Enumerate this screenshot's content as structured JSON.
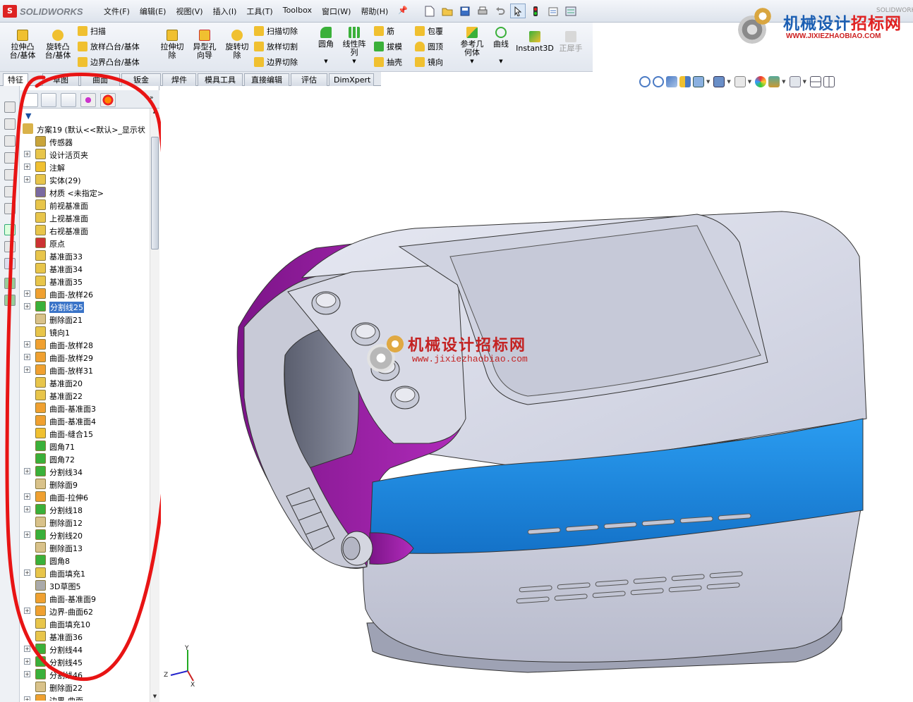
{
  "app": {
    "name": "SOLIDWORKS",
    "logo_icon": "sw-logo-icon"
  },
  "menus": [
    "文件(F)",
    "编辑(E)",
    "视图(V)",
    "插入(I)",
    "工具(T)",
    "Toolbox",
    "窗口(W)",
    "帮助(H)"
  ],
  "quick_access": [
    {
      "icon": "new-document-icon"
    },
    {
      "icon": "open-folder-icon"
    },
    {
      "icon": "save-icon"
    },
    {
      "icon": "print-icon"
    },
    {
      "icon": "undo-icon"
    },
    {
      "icon": "select-arrow-icon"
    },
    {
      "icon": "rebuild-traffic-light-icon"
    },
    {
      "icon": "file-properties-icon"
    },
    {
      "icon": "options-icon"
    }
  ],
  "brand": {
    "name_a": "机械设计",
    "name_b": "招标网",
    "url": "WWW.JIXIEZHAOBIAO.COM",
    "corner": "SOLIDWORKS"
  },
  "command_manager": {
    "extrude_boss": "拉伸凸\n台/基体",
    "revolve_boss": "旋转凸\n台/基体",
    "sweep": "扫描",
    "loft_boss": "放样凸台/基体",
    "boundary_boss": "边界凸台/基体",
    "extrude_cut": "拉伸切\n除",
    "hole_wizard": "异型孔\n向导",
    "revolve_cut": "旋转切\n除",
    "swept_cut": "扫描切除",
    "lofted_cut": "放样切割",
    "boundary_cut": "边界切除",
    "fillet": "圆角",
    "linear_pattern": "线性阵\n列",
    "rib": "筋",
    "draft": "拔模",
    "shell": "抽壳",
    "wrap": "包覆",
    "dome": "圆顶",
    "mirror": "镜向",
    "ref_geometry": "参考几\n何体",
    "curves": "曲线",
    "instant3d": "Instant3D",
    "rhino": "正犀手"
  },
  "tabs": [
    {
      "label": "特征",
      "active": true
    },
    {
      "label": "草图"
    },
    {
      "label": "曲面"
    },
    {
      "label": "钣金"
    },
    {
      "label": "焊件"
    },
    {
      "label": "模具工具"
    },
    {
      "label": "直接编辑"
    },
    {
      "label": "评估"
    },
    {
      "label": "DimXpert"
    }
  ],
  "view_toolbar": [
    {
      "icon": "zoom-to-fit-icon"
    },
    {
      "icon": "zoom-to-area-icon"
    },
    {
      "icon": "previous-view-icon"
    },
    {
      "icon": "section-view-icon"
    },
    {
      "icon": "view-orientation-icon"
    },
    {
      "icon": "display-style-icon"
    },
    {
      "icon": "hide-show-items-icon"
    },
    {
      "icon": "edit-appearance-icon"
    },
    {
      "icon": "apply-scene-icon"
    },
    {
      "icon": "view-settings-icon"
    },
    {
      "icon": "split-horizontal-icon"
    },
    {
      "icon": "split-window-icon"
    }
  ],
  "feature_tree": {
    "root": "方案19  (默认<<默认>_显示状",
    "items": [
      {
        "label": "传感器",
        "icon": "sensor-icon",
        "exp": false
      },
      {
        "label": "设计活页夹",
        "icon": "design-binder-icon",
        "exp": true
      },
      {
        "label": "注解",
        "icon": "annotations-icon",
        "exp": true
      },
      {
        "label": "实体(29)",
        "icon": "solid-bodies-icon",
        "exp": true
      },
      {
        "label": "材质 <未指定>",
        "icon": "material-icon",
        "exp": false
      },
      {
        "label": "前视基准面",
        "icon": "plane-icon",
        "exp": false
      },
      {
        "label": "上视基准面",
        "icon": "plane-icon",
        "exp": false
      },
      {
        "label": "右视基准面",
        "icon": "plane-icon",
        "exp": false
      },
      {
        "label": "原点",
        "icon": "origin-icon",
        "exp": false
      },
      {
        "label": "基准面33",
        "icon": "plane-icon",
        "exp": false
      },
      {
        "label": "基准面34",
        "icon": "plane-icon",
        "exp": false
      },
      {
        "label": "基准面35",
        "icon": "plane-icon",
        "exp": false
      },
      {
        "label": "曲面-放样26",
        "icon": "surface-loft-icon",
        "exp": true
      },
      {
        "label": "分割线25",
        "icon": "split-line-icon",
        "exp": true,
        "selected": true
      },
      {
        "label": "删除面21",
        "icon": "delete-face-icon",
        "exp": false
      },
      {
        "label": "镜向1",
        "icon": "mirror-feature-icon",
        "exp": false
      },
      {
        "label": "曲面-放样28",
        "icon": "surface-loft-icon",
        "exp": true
      },
      {
        "label": "曲面-放样29",
        "icon": "surface-loft-icon",
        "exp": true
      },
      {
        "label": "曲面-放样31",
        "icon": "surface-loft-icon",
        "exp": true
      },
      {
        "label": "基准面20",
        "icon": "plane-icon",
        "exp": false
      },
      {
        "label": "基准面22",
        "icon": "plane-icon",
        "exp": false
      },
      {
        "label": "曲面-基准面3",
        "icon": "planar-surface-icon",
        "exp": false
      },
      {
        "label": "曲面-基准面4",
        "icon": "planar-surface-icon",
        "exp": false
      },
      {
        "label": "曲面-缝合15",
        "icon": "knit-surface-icon",
        "exp": false
      },
      {
        "label": "圆角71",
        "icon": "fillet-icon",
        "exp": false
      },
      {
        "label": "圆角72",
        "icon": "fillet-icon",
        "exp": false
      },
      {
        "label": "分割线34",
        "icon": "split-line-icon",
        "exp": true
      },
      {
        "label": "删除面9",
        "icon": "delete-face-icon",
        "exp": false
      },
      {
        "label": "曲面-拉伸6",
        "icon": "surface-extrude-icon",
        "exp": true
      },
      {
        "label": "分割线18",
        "icon": "split-line-icon",
        "exp": true
      },
      {
        "label": "删除面12",
        "icon": "delete-face-icon",
        "exp": false
      },
      {
        "label": "分割线20",
        "icon": "split-line-icon",
        "exp": true
      },
      {
        "label": "删除面13",
        "icon": "delete-face-icon",
        "exp": false
      },
      {
        "label": "圆角8",
        "icon": "fillet-icon",
        "exp": false
      },
      {
        "label": "曲面填充1",
        "icon": "fill-surface-icon",
        "exp": true
      },
      {
        "label": "3D草图5",
        "icon": "sketch3d-icon",
        "exp": false
      },
      {
        "label": "曲面-基准面9",
        "icon": "planar-surface-icon",
        "exp": false
      },
      {
        "label": "边界-曲面62",
        "icon": "boundary-surface-icon",
        "exp": true
      },
      {
        "label": "曲面填充10",
        "icon": "fill-surface-icon",
        "exp": false
      },
      {
        "label": "基准面36",
        "icon": "plane-icon",
        "exp": false
      },
      {
        "label": "分割线44",
        "icon": "split-line-icon",
        "exp": true
      },
      {
        "label": "分割线45",
        "icon": "split-line-icon",
        "exp": true
      },
      {
        "label": "分割线46",
        "icon": "split-line-icon",
        "exp": true
      },
      {
        "label": "删除面22",
        "icon": "delete-face-icon",
        "exp": false
      },
      {
        "label": "边界-曲面",
        "icon": "boundary-surface-icon",
        "exp": true
      }
    ]
  },
  "watermark": {
    "name": "机械设计招标网",
    "url": "www.jixiezhaobiao.com"
  },
  "colors": {
    "purple": "#a01ea8",
    "blue": "#1f8fe0",
    "body": "#d2d5e3",
    "annotation": "#e81414"
  },
  "triad": {
    "x": "X",
    "y": "Y",
    "z": "Z"
  }
}
